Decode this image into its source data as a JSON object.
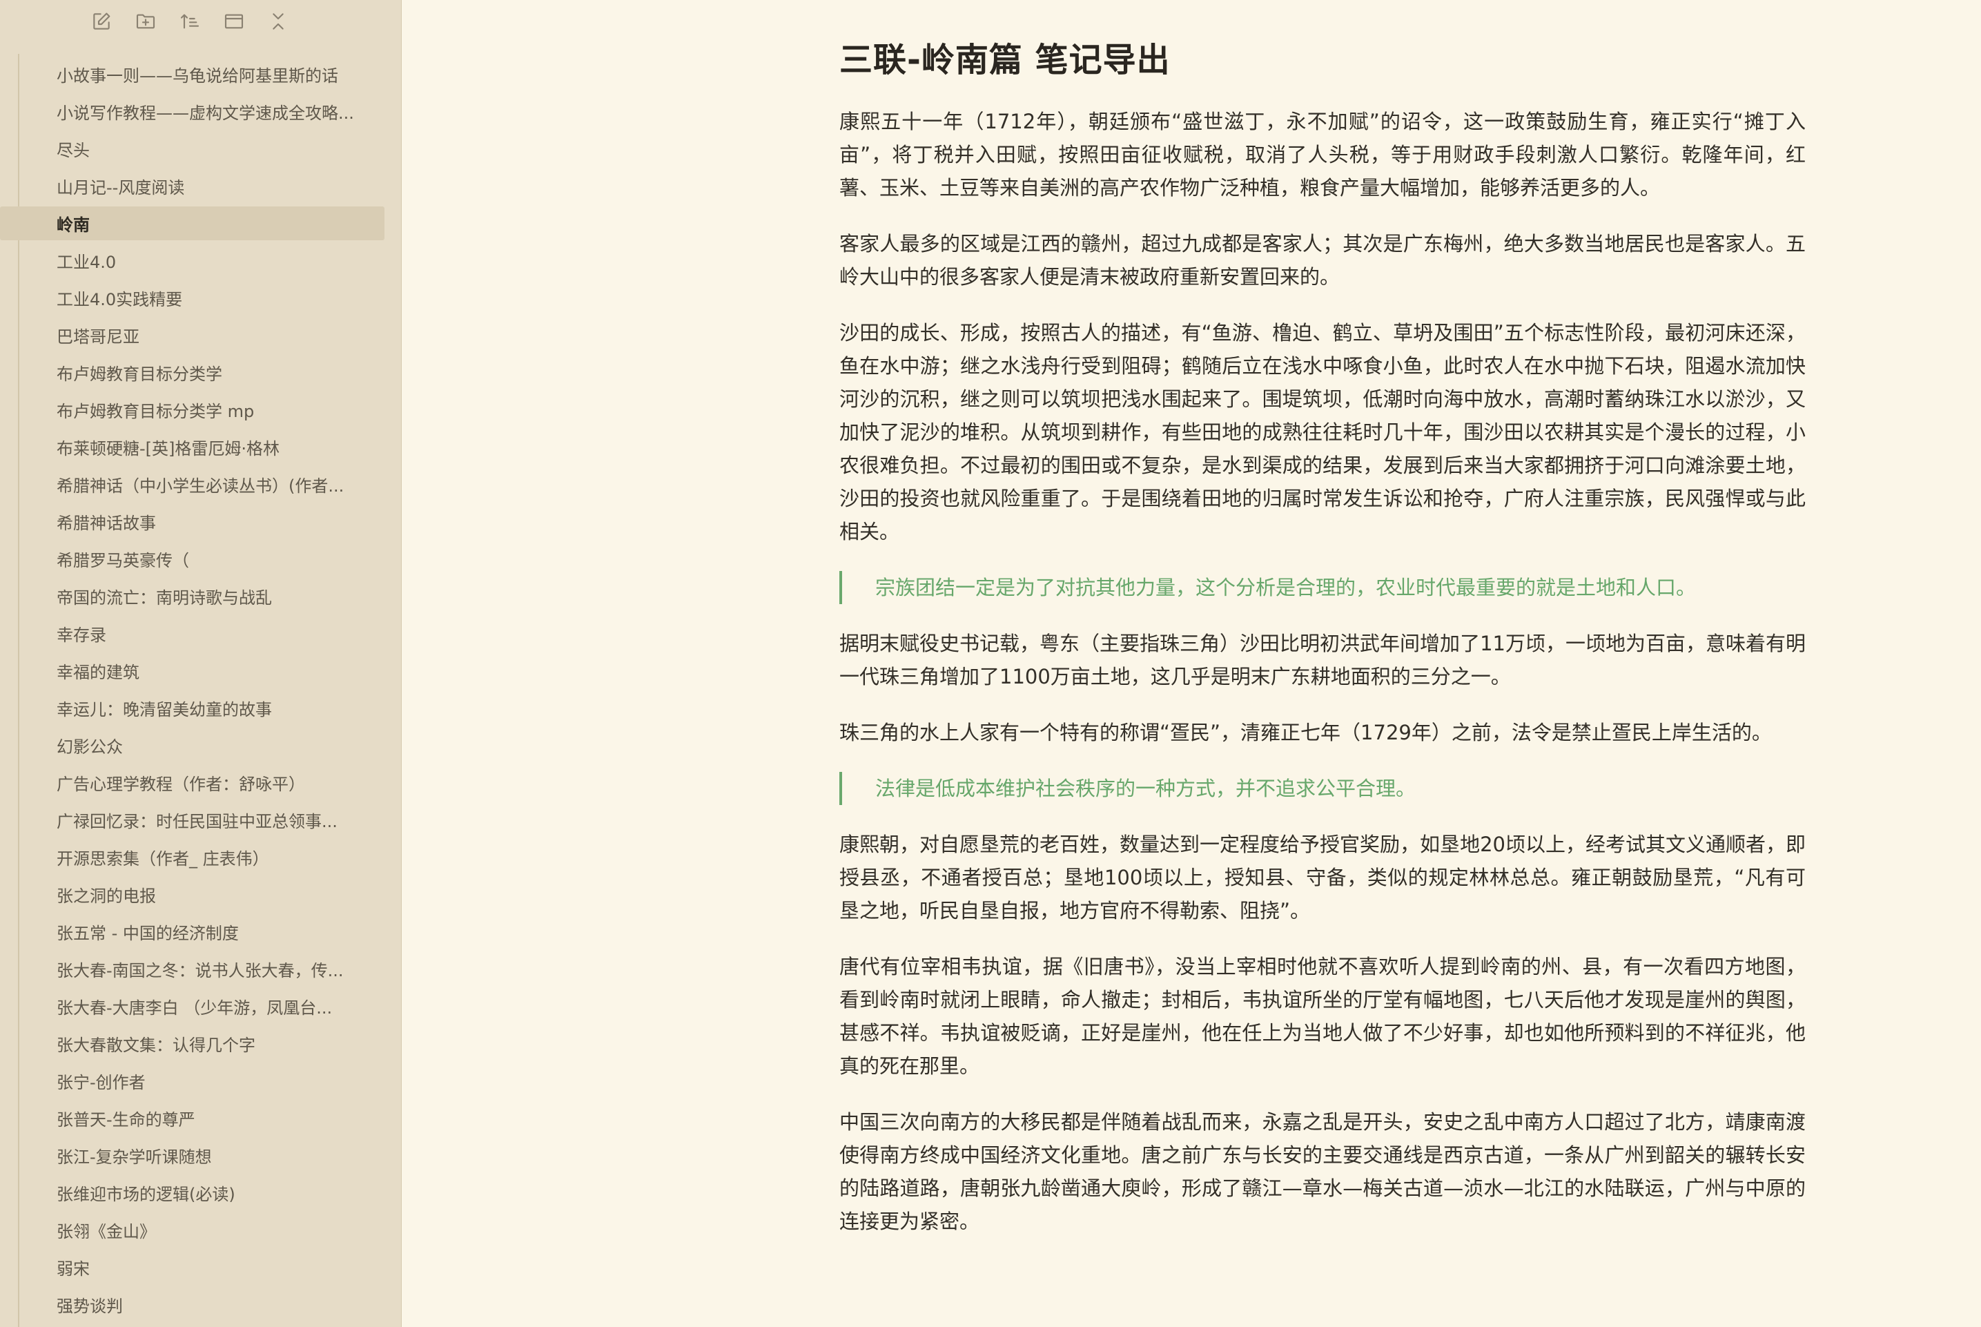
{
  "sidebar": {
    "toolbar": [
      {
        "name": "new-note-icon"
      },
      {
        "name": "new-folder-icon"
      },
      {
        "name": "sort-icon"
      },
      {
        "name": "view-icon"
      },
      {
        "name": "collapse-icon"
      }
    ],
    "active_index": 4,
    "files": [
      "小故事一则——乌龟说给阿基里斯的话",
      "小说写作教程——虚构文学速成全攻略...",
      "尽头",
      "山月记--风度阅读",
      "岭南",
      "工业4.0",
      "工业4.0实践精要",
      "巴塔哥尼亚",
      "布卢姆教育目标分类学",
      "布卢姆教育目标分类学 mp",
      "布莱顿硬糖-[英]格雷厄姆·格林",
      "希腊神话（中小学生必读丛书）(作者...",
      "希腊神话故事",
      "希腊罗马英豪传（",
      "帝国的流亡：南明诗歌与战乱",
      "幸存录",
      "幸福的建筑",
      "幸运儿：晚清留美幼童的故事",
      "幻影公众",
      "广告心理学教程（作者：舒咏平）",
      "广禄回忆录：时任民国驻中亚总领事...",
      "开源思索集（作者_ 庄表伟）",
      "张之洞的电报",
      "张五常 - 中国的经济制度",
      "张大春-南国之冬：说书人张大春，传...",
      "张大春-大唐李白 （少年游，凤凰台...",
      "张大春散文集：认得几个字",
      "张宁-创作者",
      "张普天-生命的尊严",
      "张江-复杂学听课随想",
      "张维迎市场的逻辑(必读)",
      "张翎《金山》",
      "弱宋",
      "强势谈判"
    ]
  },
  "document": {
    "title": "三联-岭南篇 笔记导出",
    "blocks": [
      {
        "type": "p",
        "text": "康熙五十一年（1712年），朝廷颁布“盛世滋丁，永不加赋”的诏令，这一政策鼓励生育，雍正实行“摊丁入亩”，将丁税并入田赋，按照田亩征收赋税，取消了人头税，等于用财政手段刺激人口繁衍。乾隆年间，红薯、玉米、土豆等来自美洲的高产农作物广泛种植，粮食产量大幅增加，能够养活更多的人。"
      },
      {
        "type": "p",
        "text": "客家人最多的区域是江西的赣州，超过九成都是客家人；其次是广东梅州，绝大多数当地居民也是客家人。五岭大山中的很多客家人便是清末被政府重新安置回来的。"
      },
      {
        "type": "p",
        "text": "沙田的成长、形成，按照古人的描述，有“鱼游、橹迫、鹤立、草坍及围田”五个标志性阶段，最初河床还深，鱼在水中游；继之水浅舟行受到阻碍；鹤随后立在浅水中啄食小鱼，此时农人在水中抛下石块，阻遏水流加快河沙的沉积，继之则可以筑坝把浅水围起来了。围堤筑坝，低潮时向海中放水，高潮时蓄纳珠江水以淤沙，又加快了泥沙的堆积。从筑坝到耕作，有些田地的成熟往往耗时几十年，围沙田以农耕其实是个漫长的过程，小农很难负担。不过最初的围田或不复杂，是水到渠成的结果，发展到后来当大家都拥挤于河口向滩涂要土地，沙田的投资也就风险重重了。于是围绕着田地的归属时常发生诉讼和抢夺，广府人注重宗族，民风强悍或与此相关。"
      },
      {
        "type": "quote",
        "text": "宗族团结一定是为了对抗其他力量，这个分析是合理的，农业时代最重要的就是土地和人口。"
      },
      {
        "type": "p",
        "text": "据明末赋役史书记载，粤东（主要指珠三角）沙田比明初洪武年间增加了11万顷，一顷地为百亩，意味着有明一代珠三角增加了1100万亩土地，这几乎是明末广东耕地面积的三分之一。"
      },
      {
        "type": "p",
        "text": "珠三角的水上人家有一个特有的称谓“疍民”，清雍正七年（1729年）之前，法令是禁止疍民上岸生活的。"
      },
      {
        "type": "quote",
        "text": "法律是低成本维护社会秩序的一种方式，并不追求公平合理。"
      },
      {
        "type": "p",
        "text": "康熙朝，对自愿垦荒的老百姓，数量达到一定程度给予授官奖励，如垦地20顷以上，经考试其文义通顺者，即授县丞，不通者授百总；垦地100顷以上，授知县、守备，类似的规定林林总总。雍正朝鼓励垦荒，“凡有可垦之地，听民自垦自报，地方官府不得勒索、阻挠”。"
      },
      {
        "type": "p",
        "text": "唐代有位宰相韦执谊，据《旧唐书》，没当上宰相时他就不喜欢听人提到岭南的州、县，有一次看四方地图，看到岭南时就闭上眼睛，命人撤走；封相后，韦执谊所坐的厅堂有幅地图，七八天后他才发现是崖州的舆图，甚感不祥。韦执谊被贬谪，正好是崖州，他在任上为当地人做了不少好事，却也如他所预料到的不祥征兆，他真的死在那里。"
      },
      {
        "type": "p",
        "text": "中国三次向南方的大移民都是伴随着战乱而来，永嘉之乱是开头，安史之乱中南方人口超过了北方，靖康南渡使得南方终成中国经济文化重地。唐之前广东与长安的主要交通线是西京古道，一条从广州到韶关的辗转长安的陆路道路，唐朝张九龄凿通大庾岭，形成了赣江—章水—梅关古道—浈水—北江的水陆联运，广州与中原的连接更为紧密。"
      }
    ]
  }
}
